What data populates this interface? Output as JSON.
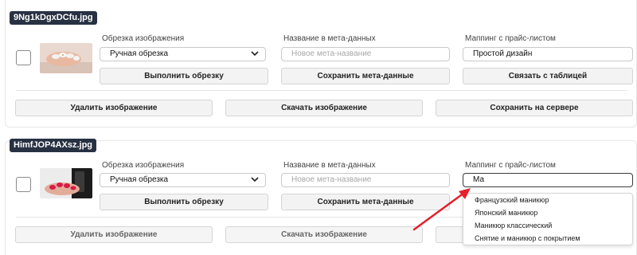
{
  "labels": {
    "crop": "Обрезка изображения",
    "meta": "Название в мета-данных",
    "mapping": "Маппинг с прайс-листом"
  },
  "buttons": {
    "crop": "Выполнить обрезку",
    "save_meta": "Сохранить мета-данные",
    "link_table": "Связать с таблицей",
    "delete": "Удалить изображение",
    "download": "Скачать изображение",
    "save_server": "Сохранить на сервере"
  },
  "cards": [
    {
      "filename": "9Ng1kDgxDCfu.jpg",
      "crop_value": "Ручная обрезка",
      "meta_placeholder": "Новое мета-название",
      "mapping_value": "Простой дизайн"
    },
    {
      "filename": "HimfJOP4AXsz.jpg",
      "crop_value": "Ручная обрезка",
      "meta_placeholder": "Новое мета-название",
      "mapping_value": "Ма"
    }
  ],
  "dropdown": {
    "options": [
      "Французский маникюр",
      "Японский маникюр",
      "Маникюр классический",
      "Снятие и маникюр с покрытием"
    ]
  },
  "colors": {
    "filename_bg": "#273142",
    "arrow": "#e5202a"
  },
  "icons": {
    "select_chevron": "chevron-down-icon"
  }
}
